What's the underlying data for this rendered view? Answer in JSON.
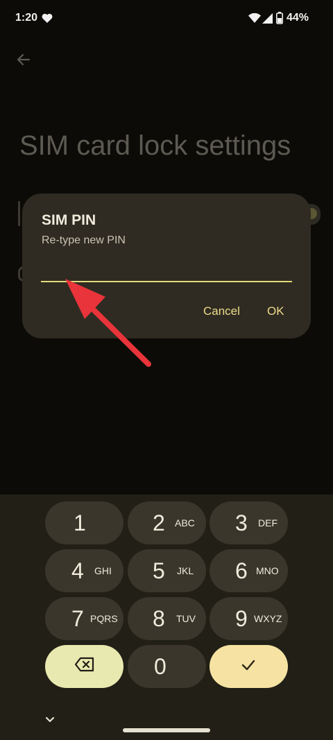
{
  "status_bar": {
    "time": "1:20",
    "battery": "44%"
  },
  "page": {
    "title": "SIM card lock settings"
  },
  "dialog": {
    "title": "SIM PIN",
    "subtitle": "Re-type new PIN",
    "input_value": "",
    "cancel_label": "Cancel",
    "ok_label": "OK"
  },
  "keypad": {
    "keys": [
      {
        "digit": "1",
        "letters": ""
      },
      {
        "digit": "2",
        "letters": "ABC"
      },
      {
        "digit": "3",
        "letters": "DEF"
      },
      {
        "digit": "4",
        "letters": "GHI"
      },
      {
        "digit": "5",
        "letters": "JKL"
      },
      {
        "digit": "6",
        "letters": "MNO"
      },
      {
        "digit": "7",
        "letters": "PQRS"
      },
      {
        "digit": "8",
        "letters": "TUV"
      },
      {
        "digit": "9",
        "letters": "WXYZ"
      },
      {
        "digit": "0",
        "letters": ""
      }
    ]
  },
  "colors": {
    "accent": "#eddc8a",
    "annotation_arrow": "#e8343a",
    "dialog_bg": "#2f2b22"
  }
}
